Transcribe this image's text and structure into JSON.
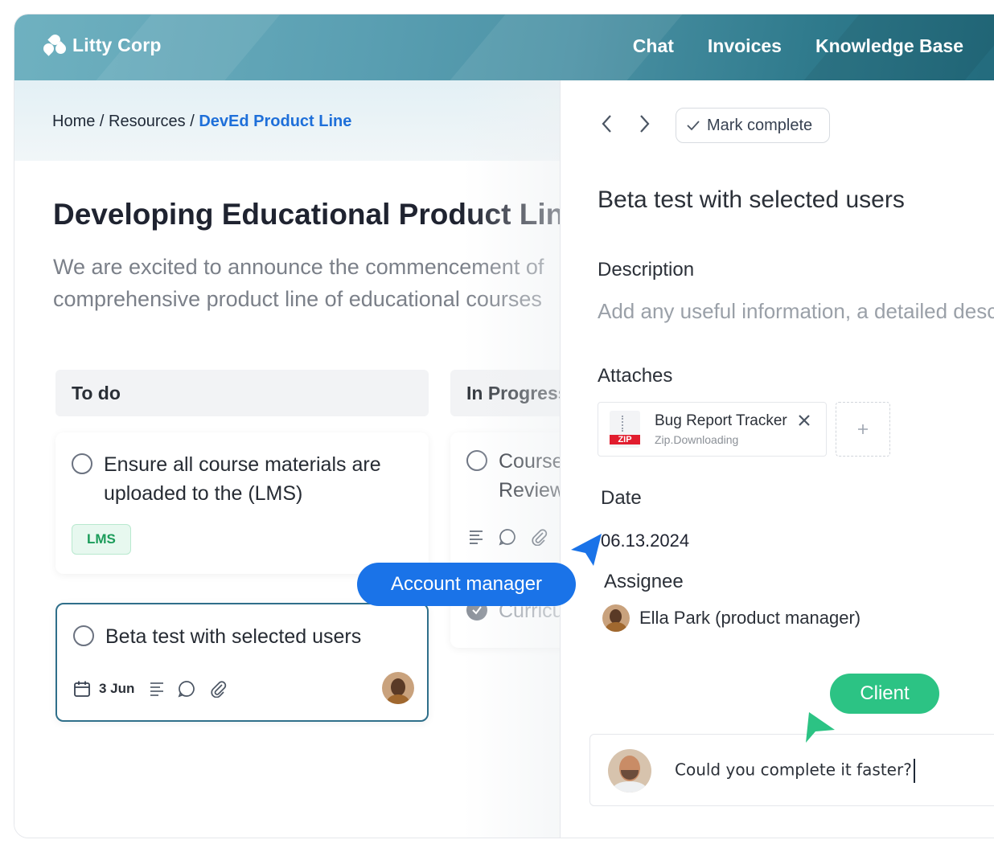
{
  "brand": {
    "name": "Litty Corp"
  },
  "nav": {
    "items": [
      "Chat",
      "Invoices",
      "Knowledge Base"
    ]
  },
  "breadcrumb": {
    "items": [
      "Home",
      "Resources"
    ],
    "current": "DevEd Product Line",
    "separator": "/"
  },
  "page": {
    "title": "Developing Educational Product Line",
    "description": "We are excited to announce the commencement of comprehensive product line of educational courses"
  },
  "board": {
    "columns": [
      {
        "title": "To do"
      },
      {
        "title": "In Progress"
      }
    ],
    "todo_cards": [
      {
        "title": "Ensure all course materials are uploaded to the (LMS)",
        "tag": "LMS"
      },
      {
        "title": "Beta test with selected users",
        "date": "3 Jun"
      }
    ],
    "progress_cards": [
      {
        "title": "Course Review"
      },
      {
        "title": "Curriculum"
      }
    ]
  },
  "detail": {
    "mark_complete": "Mark complete",
    "title": "Beta test with selected users",
    "description_label": "Description",
    "description_placeholder": "Add any useful information, a detailed description",
    "attaches_label": "Attaches",
    "file": {
      "name": "Bug Report Tracker",
      "status": "Zip.Downloading",
      "type": "ZIP"
    },
    "date_label": "Date",
    "date_value": "06.13.2024",
    "assignee_label": "Assignee",
    "assignee_name": "Ella Park (product manager)",
    "comment": "Could you complete it faster?"
  },
  "labels": {
    "account_manager": "Account manager",
    "client": "Client"
  },
  "colors": {
    "link": "#1e6fd9",
    "account_manager": "#1a73e8",
    "client": "#2cc384",
    "tag_text": "#1b9c5a"
  }
}
